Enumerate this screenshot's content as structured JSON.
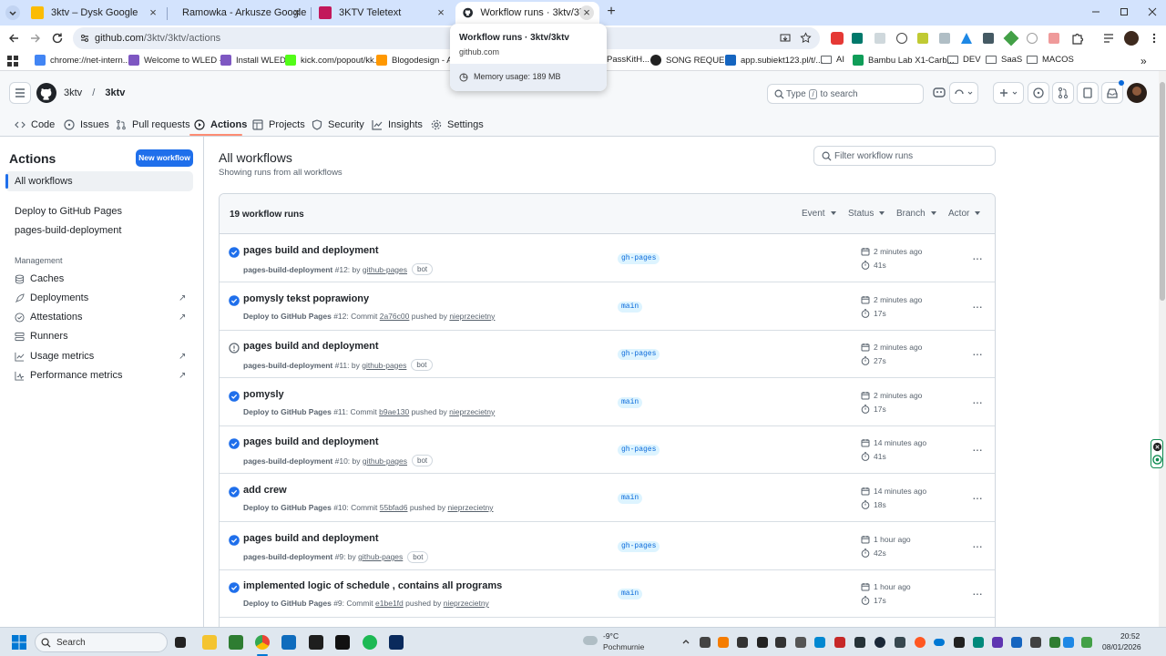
{
  "browser": {
    "tabs": [
      {
        "label": "3ktv – Dysk Google",
        "color": "#fbbc04"
      },
      {
        "label": "Ramowka - Arkusze Google",
        "color": "#0f9d58"
      },
      {
        "label": "3KTV Teletext",
        "color": "#c2185b"
      },
      {
        "label": "Workflow runs · 3ktv/3ktv",
        "color": "#24292f"
      }
    ],
    "url_host": "github.com",
    "url_path": "/3ktv/3ktv/actions",
    "hovercard": {
      "title": "Workflow runs · 3ktv/3ktv",
      "host": "github.com",
      "memory": "Memory usage: 189 MB"
    },
    "bookmarks": [
      {
        "label": "chrome://net-intern...",
        "color": "#4285f4"
      },
      {
        "label": "Welcome to WLED -...",
        "color": "#7e57c2"
      },
      {
        "label": "Install WLED",
        "color": "#7e57c2"
      },
      {
        "label": "kick.com/popout/kk...",
        "color": "#53fc18"
      },
      {
        "label": "Blogodesign - Ars",
        "color": "#ff9800"
      },
      {
        "label": "PassKitH...",
        "color": "#999999"
      },
      {
        "label": "SONG REQUEST",
        "color": "#222222"
      },
      {
        "label": "app.subiekt123.pl/t/...",
        "color": "#1565c0"
      },
      {
        "label": "AI",
        "color": "#5f6368"
      },
      {
        "label": "Bambu Lab X1-Carb...",
        "color": "#0f9d58"
      },
      {
        "label": "DEV",
        "color": "#5f6368"
      },
      {
        "label": "SaaS",
        "color": "#5f6368"
      },
      {
        "label": "MACOS",
        "color": "#5f6368"
      }
    ]
  },
  "github": {
    "owner": "3ktv",
    "repo": "3ktv",
    "search_prefix": "Type",
    "search_key": "/",
    "search_suffix": "to search",
    "nav": [
      "Code",
      "Issues",
      "Pull requests",
      "Actions",
      "Projects",
      "Security",
      "Insights",
      "Settings"
    ]
  },
  "sidebar": {
    "title": "Actions",
    "new_workflow": "New workflow",
    "all_workflows": "All workflows",
    "workflows": [
      "Deploy to GitHub Pages",
      "pages-build-deployment"
    ],
    "management_label": "Management",
    "management": [
      {
        "label": "Caches",
        "external": ""
      },
      {
        "label": "Deployments",
        "external": "↗"
      },
      {
        "label": "Attestations",
        "external": "↗"
      },
      {
        "label": "Runners",
        "external": ""
      },
      {
        "label": "Usage metrics",
        "external": "↗"
      },
      {
        "label": "Performance metrics",
        "external": "↗"
      }
    ]
  },
  "main": {
    "title": "All workflows",
    "subtitle": "Showing runs from all workflows",
    "filter_placeholder": "Filter workflow runs",
    "count": "19 workflow runs",
    "filters": [
      "Event",
      "Status",
      "Branch",
      "Actor"
    ],
    "runs": [
      {
        "title": "pages build and deployment",
        "workflow": "pages-build-deployment",
        "num": "#12:",
        "pre": " by ",
        "link": "github-pages",
        "post": "",
        "user": "",
        "bot": "bot",
        "branch": "gh-pages",
        "when": "2 minutes ago",
        "dur": "41s",
        "status": "success"
      },
      {
        "title": "pomysly tekst poprawiony",
        "workflow": "Deploy to GitHub Pages",
        "num": "#12:",
        "pre": " Commit ",
        "link": "2a76c00",
        "post": " pushed by ",
        "user": "nieprzecietny",
        "bot": "",
        "branch": "main",
        "when": "2 minutes ago",
        "dur": "17s",
        "status": "success"
      },
      {
        "title": "pages build and deployment",
        "workflow": "pages-build-deployment",
        "num": "#11:",
        "pre": " by ",
        "link": "github-pages",
        "post": "",
        "user": "",
        "bot": "bot",
        "branch": "gh-pages",
        "when": "2 minutes ago",
        "dur": "27s",
        "status": "neutral"
      },
      {
        "title": "pomysly",
        "workflow": "Deploy to GitHub Pages",
        "num": "#11:",
        "pre": " Commit ",
        "link": "b9ae130",
        "post": " pushed by ",
        "user": "nieprzecietny",
        "bot": "",
        "branch": "main",
        "when": "2 minutes ago",
        "dur": "17s",
        "status": "success"
      },
      {
        "title": "pages build and deployment",
        "workflow": "pages-build-deployment",
        "num": "#10:",
        "pre": " by ",
        "link": "github-pages",
        "post": "",
        "user": "",
        "bot": "bot",
        "branch": "gh-pages",
        "when": "14 minutes ago",
        "dur": "41s",
        "status": "success"
      },
      {
        "title": "add crew",
        "workflow": "Deploy to GitHub Pages",
        "num": "#10:",
        "pre": " Commit ",
        "link": "55bfad6",
        "post": " pushed by ",
        "user": "nieprzecietny",
        "bot": "",
        "branch": "main",
        "when": "14 minutes ago",
        "dur": "18s",
        "status": "success"
      },
      {
        "title": "pages build and deployment",
        "workflow": "pages-build-deployment",
        "num": "#9:",
        "pre": " by ",
        "link": "github-pages",
        "post": "",
        "user": "",
        "bot": "bot",
        "branch": "gh-pages",
        "when": "1 hour ago",
        "dur": "42s",
        "status": "success"
      },
      {
        "title": "implemented logic of schedule , contains all programs",
        "workflow": "Deploy to GitHub Pages",
        "num": "#9:",
        "pre": " Commit ",
        "link": "e1be1fd",
        "post": " pushed by ",
        "user": "nieprzecietny",
        "bot": "",
        "branch": "main",
        "when": "1 hour ago",
        "dur": "17s",
        "status": "success"
      }
    ]
  },
  "taskbar": {
    "search": "Search",
    "weather_temp": "-9°C",
    "weather_desc": "Pochmurnie",
    "time": "20:52",
    "date": "08/01/2026"
  },
  "colors": {
    "success": "#1f6feb",
    "neutral": "#59636e",
    "primary_button": "#1f6feb",
    "accent_underline": "#fd8c73"
  }
}
